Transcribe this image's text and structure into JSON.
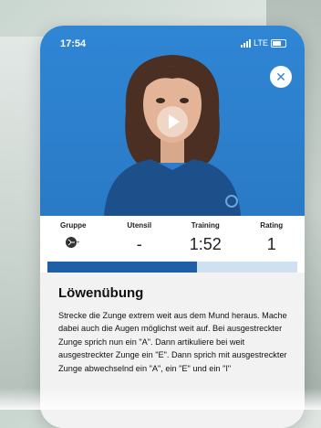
{
  "status_bar": {
    "time": "17:54",
    "network": "LTE"
  },
  "video": {
    "play_icon": "play-icon",
    "close_icon": "close-icon"
  },
  "stats": [
    {
      "label": "Gruppe",
      "icon": "group-icon"
    },
    {
      "label": "Utensil",
      "value": "-"
    },
    {
      "label": "Training",
      "value": "1:52"
    },
    {
      "label": "Rating",
      "value": "1"
    }
  ],
  "progress": {
    "fraction": 0.6
  },
  "exercise": {
    "title": "Löwenübung",
    "description": "Strecke die Zunge extrem weit aus dem Mund heraus. Mache dabei auch die Augen möglichst weit auf. Bei ausgestreckter Zunge sprich nun ein \"A\". Dann artikuliere bei weit ausgestreckter Zunge ein \"E\". Dann sprich mit ausgestreckter Zunge abwechselnd ein \"A\", ein \"E\" und ein \"I\""
  },
  "colors": {
    "video_bg": "#2f86d4",
    "progress_fill": "#1f5fa5",
    "progress_track": "#cfe0f1"
  }
}
